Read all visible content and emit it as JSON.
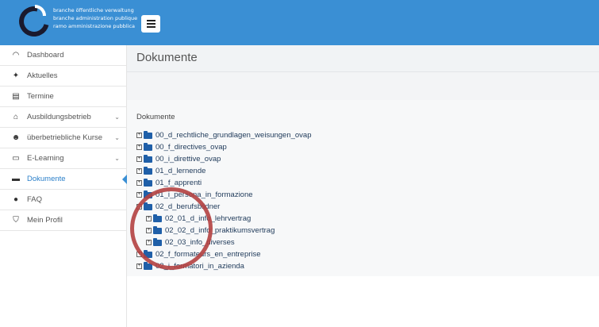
{
  "brand": {
    "lines": [
      "branche öffentliche verwaltung",
      "branche administration publique",
      "ramo amministrazione pubblica"
    ]
  },
  "sidebar": {
    "items": [
      {
        "label": "Dashboard",
        "icon": "gauge-icon"
      },
      {
        "label": "Aktuelles",
        "icon": "pin-icon"
      },
      {
        "label": "Termine",
        "icon": "list-icon"
      },
      {
        "label": "Ausbildungsbetrieb",
        "icon": "home-icon",
        "has_chevron": true
      },
      {
        "label": "überbetriebliche Kurse",
        "icon": "users-icon",
        "has_chevron": true
      },
      {
        "label": "E-Learning",
        "icon": "monitor-icon",
        "has_chevron": true
      },
      {
        "label": "Dokumente",
        "icon": "folder-icon",
        "active": true
      },
      {
        "label": "FAQ",
        "icon": "bulb-icon"
      },
      {
        "label": "Mein Profil",
        "icon": "shield-icon"
      }
    ],
    "active_color": "#2a7fc9"
  },
  "main": {
    "title": "Dokumente",
    "panel_title": "Dokumente",
    "tree": [
      {
        "label": "00_d_rechtliche_grundlagen_weisungen_ovap",
        "level": 0
      },
      {
        "label": "00_f_directives_ovap",
        "level": 0
      },
      {
        "label": "00_i_direttive_ovap",
        "level": 0
      },
      {
        "label": "01_d_lernende",
        "level": 0
      },
      {
        "label": "01_f_apprenti",
        "level": 0
      },
      {
        "label": "01_i_persona_in_formazione",
        "level": 0
      },
      {
        "label": "02_d_berufsbildner",
        "level": 0,
        "expanded": true
      },
      {
        "label": "02_01_d_info_lehrvertrag",
        "level": 1
      },
      {
        "label": "02_02_d_info_praktikumsvertrag",
        "level": 1
      },
      {
        "label": "02_03_info_diverses",
        "level": 1
      },
      {
        "label": "02_f_formateurs_en_entreprise",
        "level": 0
      },
      {
        "label": "02_i_formatori_in_azienda",
        "level": 0
      }
    ]
  },
  "colors": {
    "header": "#3a8fd4",
    "folder": "#1f5fa8",
    "annotation_circle": "#b34040"
  }
}
